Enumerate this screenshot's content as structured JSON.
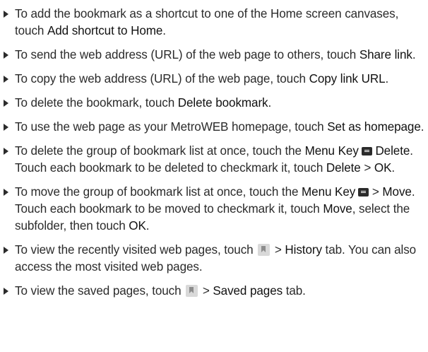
{
  "items": [
    {
      "t1": "To add the bookmark as a shortcut to one of the Home screen canvases, touch ",
      "b1": "Add shortcut to Home",
      "t2": "."
    },
    {
      "t1": "To send the web address (URL) of the web page to others, touch ",
      "b1": "Share link",
      "t2": "."
    },
    {
      "t1": "To copy the web address (URL) of the web page, touch ",
      "b1": "Copy link URL",
      "t2": "."
    },
    {
      "t1": "To delete the bookmark, touch ",
      "b1": "Delete bookmark",
      "t2": "."
    },
    {
      "t1": "To use the web page as your MetroWEB homepage, touch ",
      "b1": "Set as homepage",
      "t2": "."
    },
    {
      "t1": "To delete the group of bookmark list at once, touch the ",
      "b1": "Menu Key",
      "icon": "menu-key-icon",
      "b2": "Delete",
      "t2": ". Touch each bookmark to be deleted to checkmark it, touch ",
      "b3": "Delete",
      "t3": " > ",
      "b4": "OK",
      "t4": "."
    },
    {
      "t1": "To move the group of bookmark list at once, touch the ",
      "b1": "Menu Key",
      "icon": "menu-key-icon",
      "t2": " > ",
      "b2": "Move",
      "t3": ". Touch each bookmark to be moved to checkmark it, touch ",
      "b3": "Move",
      "t4": ", select the subfolder, then touch ",
      "b4": "OK",
      "t5": "."
    },
    {
      "t1": "To view the recently visited web pages, touch ",
      "icon": "bookmark-icon",
      "t2": " > ",
      "b1": "History",
      "t3": " tab. You can also access the most visited web pages."
    },
    {
      "t1": "To view the saved pages, touch ",
      "icon": "bookmark-icon",
      "t2": " > ",
      "b1": "Saved pages",
      "t3": " tab."
    }
  ]
}
